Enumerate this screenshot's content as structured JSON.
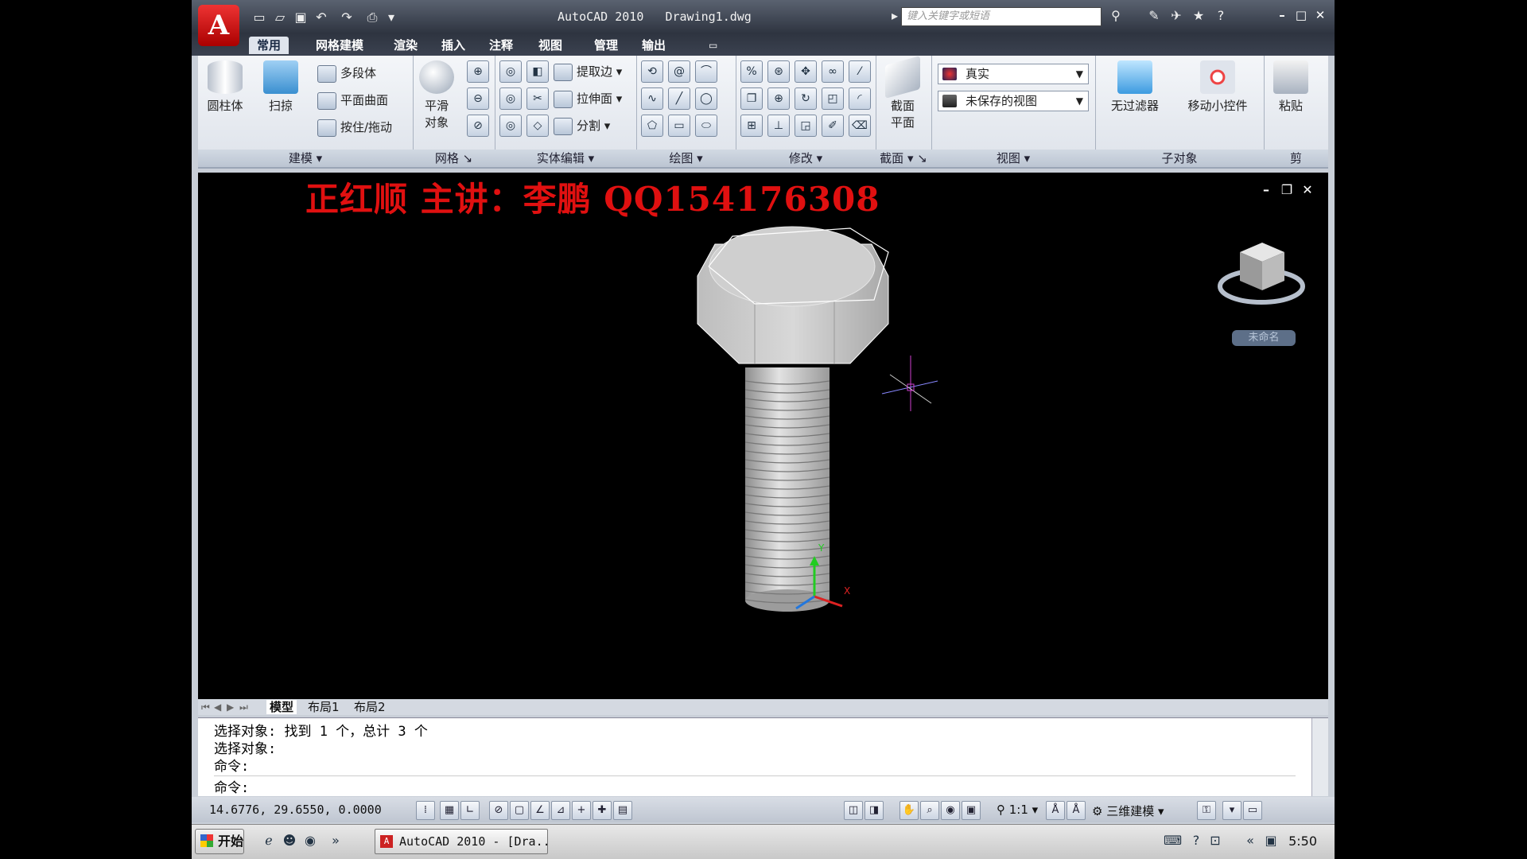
{
  "window": {
    "title": "AutoCAD 2010   Drawing1.dwg",
    "search_placeholder": "键入关键字或短语",
    "app_logo": "A"
  },
  "tabs": [
    "常用",
    "网格建模",
    "渲染",
    "插入",
    "注释",
    "视图",
    "管理",
    "输出"
  ],
  "ribbon": {
    "modeling": {
      "title": "建模",
      "cylinder": "圆柱体",
      "sweep": "扫掠",
      "polysolid": "多段体",
      "planar_surface": "平面曲面",
      "presspull": "按住/拖动"
    },
    "mesh": {
      "title": "网格",
      "smooth_object_l1": "平滑",
      "smooth_object_l2": "对象"
    },
    "solid_editing": {
      "title": "实体编辑",
      "extract_edges": "提取边",
      "extrude_faces": "拉伸面",
      "separate": "分割"
    },
    "draw": {
      "title": "绘图"
    },
    "modify": {
      "title": "修改"
    },
    "section": {
      "title": "截面",
      "section_plane_l1": "截面",
      "section_plane_l2": "平面"
    },
    "view": {
      "title": "视图",
      "visual_style": "真实",
      "saved_view": "未保存的视图"
    },
    "subobject": {
      "title": "子对象",
      "no_filter": "无过滤器",
      "move_gizmo": "移动小控件"
    },
    "clipboard": {
      "title": "剪",
      "paste": "粘贴"
    }
  },
  "drawing": {
    "watermark": "正红顺 主讲：李鹏 QQ154176308",
    "viewcube_label": "未命名",
    "ucs_x": "X",
    "ucs_y": "Y"
  },
  "layout_tabs": [
    "模型",
    "布局1",
    "布局2"
  ],
  "command": {
    "lines": [
      "选择对象: 找到 1 个，总计 3 个",
      "选择对象:",
      "命令:"
    ],
    "prompt": "命令:"
  },
  "status": {
    "coords": "14.6776, 29.6550, 0.0000",
    "scale": "1:1",
    "workspace": "三维建模"
  },
  "taskbar": {
    "start": "开始",
    "task": "AutoCAD 2010 - [Dra...",
    "clock": "5:50"
  },
  "colors": {
    "watermark": "#e01010",
    "canvas": "#000000",
    "ribbon_bg": "#dde2ea"
  }
}
